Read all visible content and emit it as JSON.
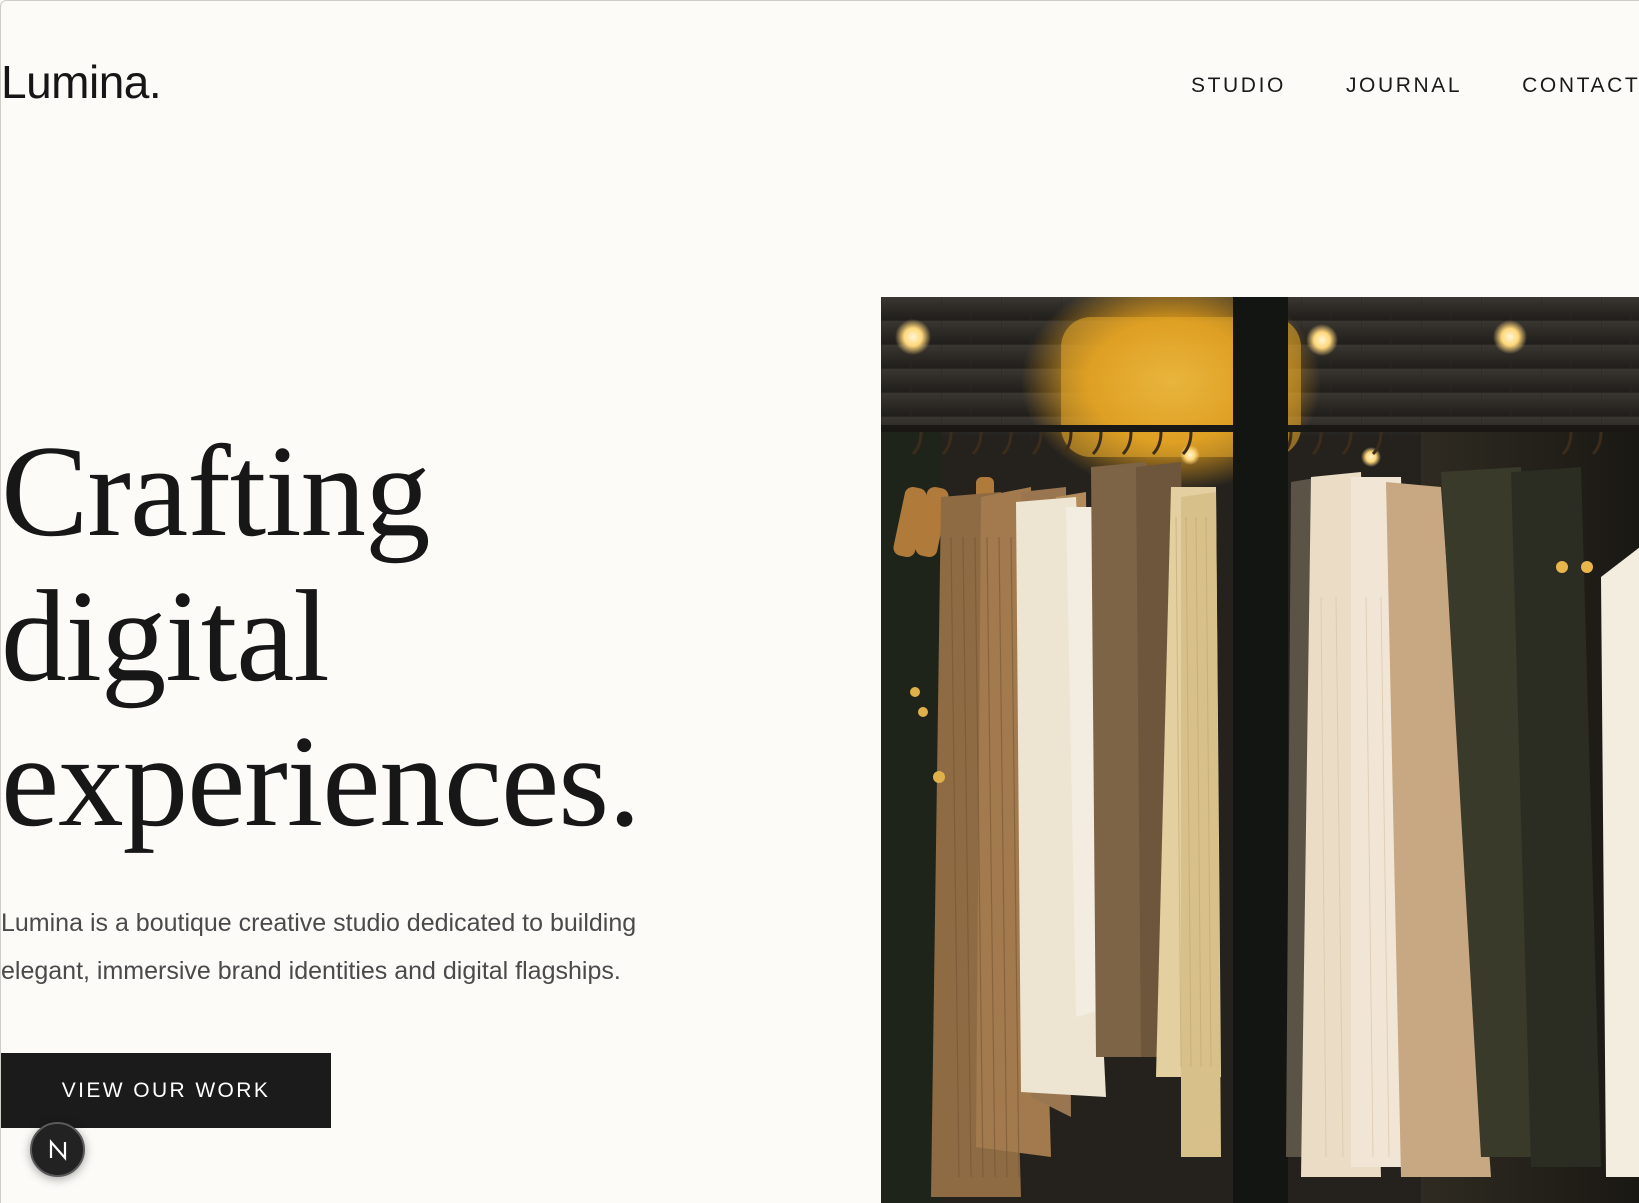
{
  "brand": {
    "logo": "Lumina."
  },
  "nav": {
    "items": [
      {
        "label": "STUDIO"
      },
      {
        "label": "JOURNAL"
      },
      {
        "label": "CONTACT"
      }
    ]
  },
  "hero": {
    "headline_lines": [
      "Crafting",
      "digital",
      "experiences."
    ],
    "intro": "Lumina is a boutique creative studio dedicated to building elegant, immersive brand identities and digital flagships.",
    "cta_label": "VIEW OUR WORK"
  },
  "floating_badge": {
    "letter": "N"
  },
  "colors": {
    "background": "#fcfbf8",
    "text": "#171717",
    "body_text": "#4a4a4a",
    "button": "#1b1b1b"
  }
}
